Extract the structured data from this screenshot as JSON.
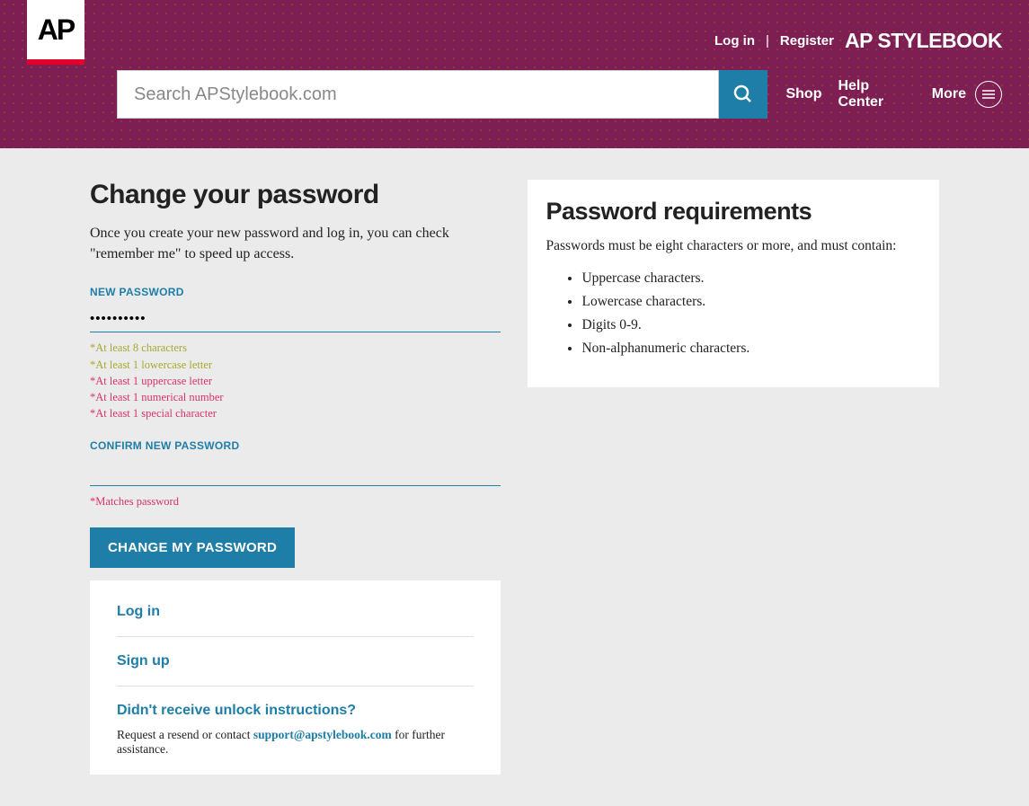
{
  "header": {
    "logo_text": "AP",
    "login": "Log in",
    "register": "Register",
    "brand": "AP STYLEBOOK",
    "search_placeholder": "Search APStylebook.com",
    "nav": {
      "shop": "Shop",
      "help": "Help Center",
      "more": "More"
    }
  },
  "main": {
    "title": "Change your password",
    "intro": "Once you create your new password and log in, you can check \"remember me\" to speed up access.",
    "new_pw_label": "NEW PASSWORD",
    "new_pw_value": "••••••••••",
    "hints": [
      {
        "text": "*At least 8 characters",
        "ok": true
      },
      {
        "text": "*At least 1 lowercase letter",
        "ok": true
      },
      {
        "text": "*At least 1 uppercase letter",
        "ok": false
      },
      {
        "text": "*At least 1 numerical number",
        "ok": false
      },
      {
        "text": "*At least 1 special character",
        "ok": false
      }
    ],
    "confirm_label": "CONFIRM NEW PASSWORD",
    "confirm_value": "",
    "confirm_hint": "*Matches password",
    "submit": "CHANGE MY PASSWORD"
  },
  "links": {
    "login": "Log in",
    "signup": "Sign up",
    "unlock": "Didn't receive unlock instructions?",
    "unlock_prefix": "Request a resend or contact ",
    "unlock_email": "support@apstylebook.com",
    "unlock_suffix": " for further assistance."
  },
  "requirements": {
    "title": "Password requirements",
    "intro": "Passwords must be eight characters or more, and must contain:",
    "items": [
      "Uppercase characters.",
      "Lowercase characters.",
      "Digits 0-9.",
      "Non-alphanumeric characters."
    ]
  }
}
